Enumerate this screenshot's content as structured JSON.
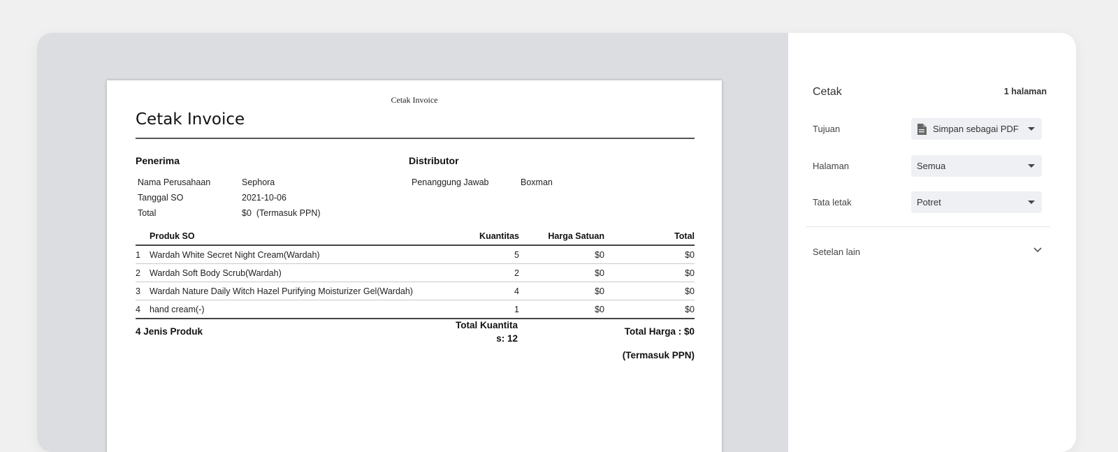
{
  "document": {
    "header_caption": "Cetak Invoice",
    "title": "Cetak Invoice",
    "recipient": {
      "heading": "Penerima",
      "fields": [
        {
          "label": "Nama Perusahaan",
          "value": "Sephora"
        },
        {
          "label": "Tanggal SO",
          "value": "2021-10-06"
        },
        {
          "label": "Total",
          "value": "$0  (Termasuk PPN)"
        }
      ]
    },
    "distributor": {
      "heading": "Distributor",
      "fields": [
        {
          "label": "Penanggung Jawab",
          "value": "Boxman"
        }
      ]
    },
    "table": {
      "headers": {
        "product": "Produk SO",
        "quantity": "Kuantitas",
        "unit_price": "Harga Satuan",
        "total": "Total"
      },
      "rows": [
        {
          "no": "1",
          "product": "Wardah White Secret Night Cream(Wardah)",
          "quantity": "5",
          "unit_price": "$0",
          "total": "$0"
        },
        {
          "no": "2",
          "product": "Wardah Soft Body Scrub(Wardah)",
          "quantity": "2",
          "unit_price": "$0",
          "total": "$0"
        },
        {
          "no": "3",
          "product": "Wardah Nature Daily Witch Hazel Purifying Moisturizer Gel(Wardah)",
          "quantity": "4",
          "unit_price": "$0",
          "total": "$0"
        },
        {
          "no": "4",
          "product": "hand cream(-)",
          "quantity": "1",
          "unit_price": "$0",
          "total": "$0"
        }
      ]
    },
    "summary": {
      "product_types": "4 Jenis Produk",
      "total_quantity_line1": "Total Kuantita",
      "total_quantity_line2": "s: 12",
      "total_price": "Total Harga : $0",
      "tax_note": "(Termasuk PPN)"
    }
  },
  "print_panel": {
    "title": "Cetak",
    "page_count": "1 halaman",
    "destination": {
      "label": "Tujuan",
      "value": "Simpan sebagai PDF",
      "icon": "document-icon"
    },
    "pages": {
      "label": "Halaman",
      "value": "Semua"
    },
    "layout": {
      "label": "Tata letak",
      "value": "Potret"
    },
    "more_settings": {
      "label": "Setelan lain",
      "icon": "chevron-down-icon"
    }
  }
}
